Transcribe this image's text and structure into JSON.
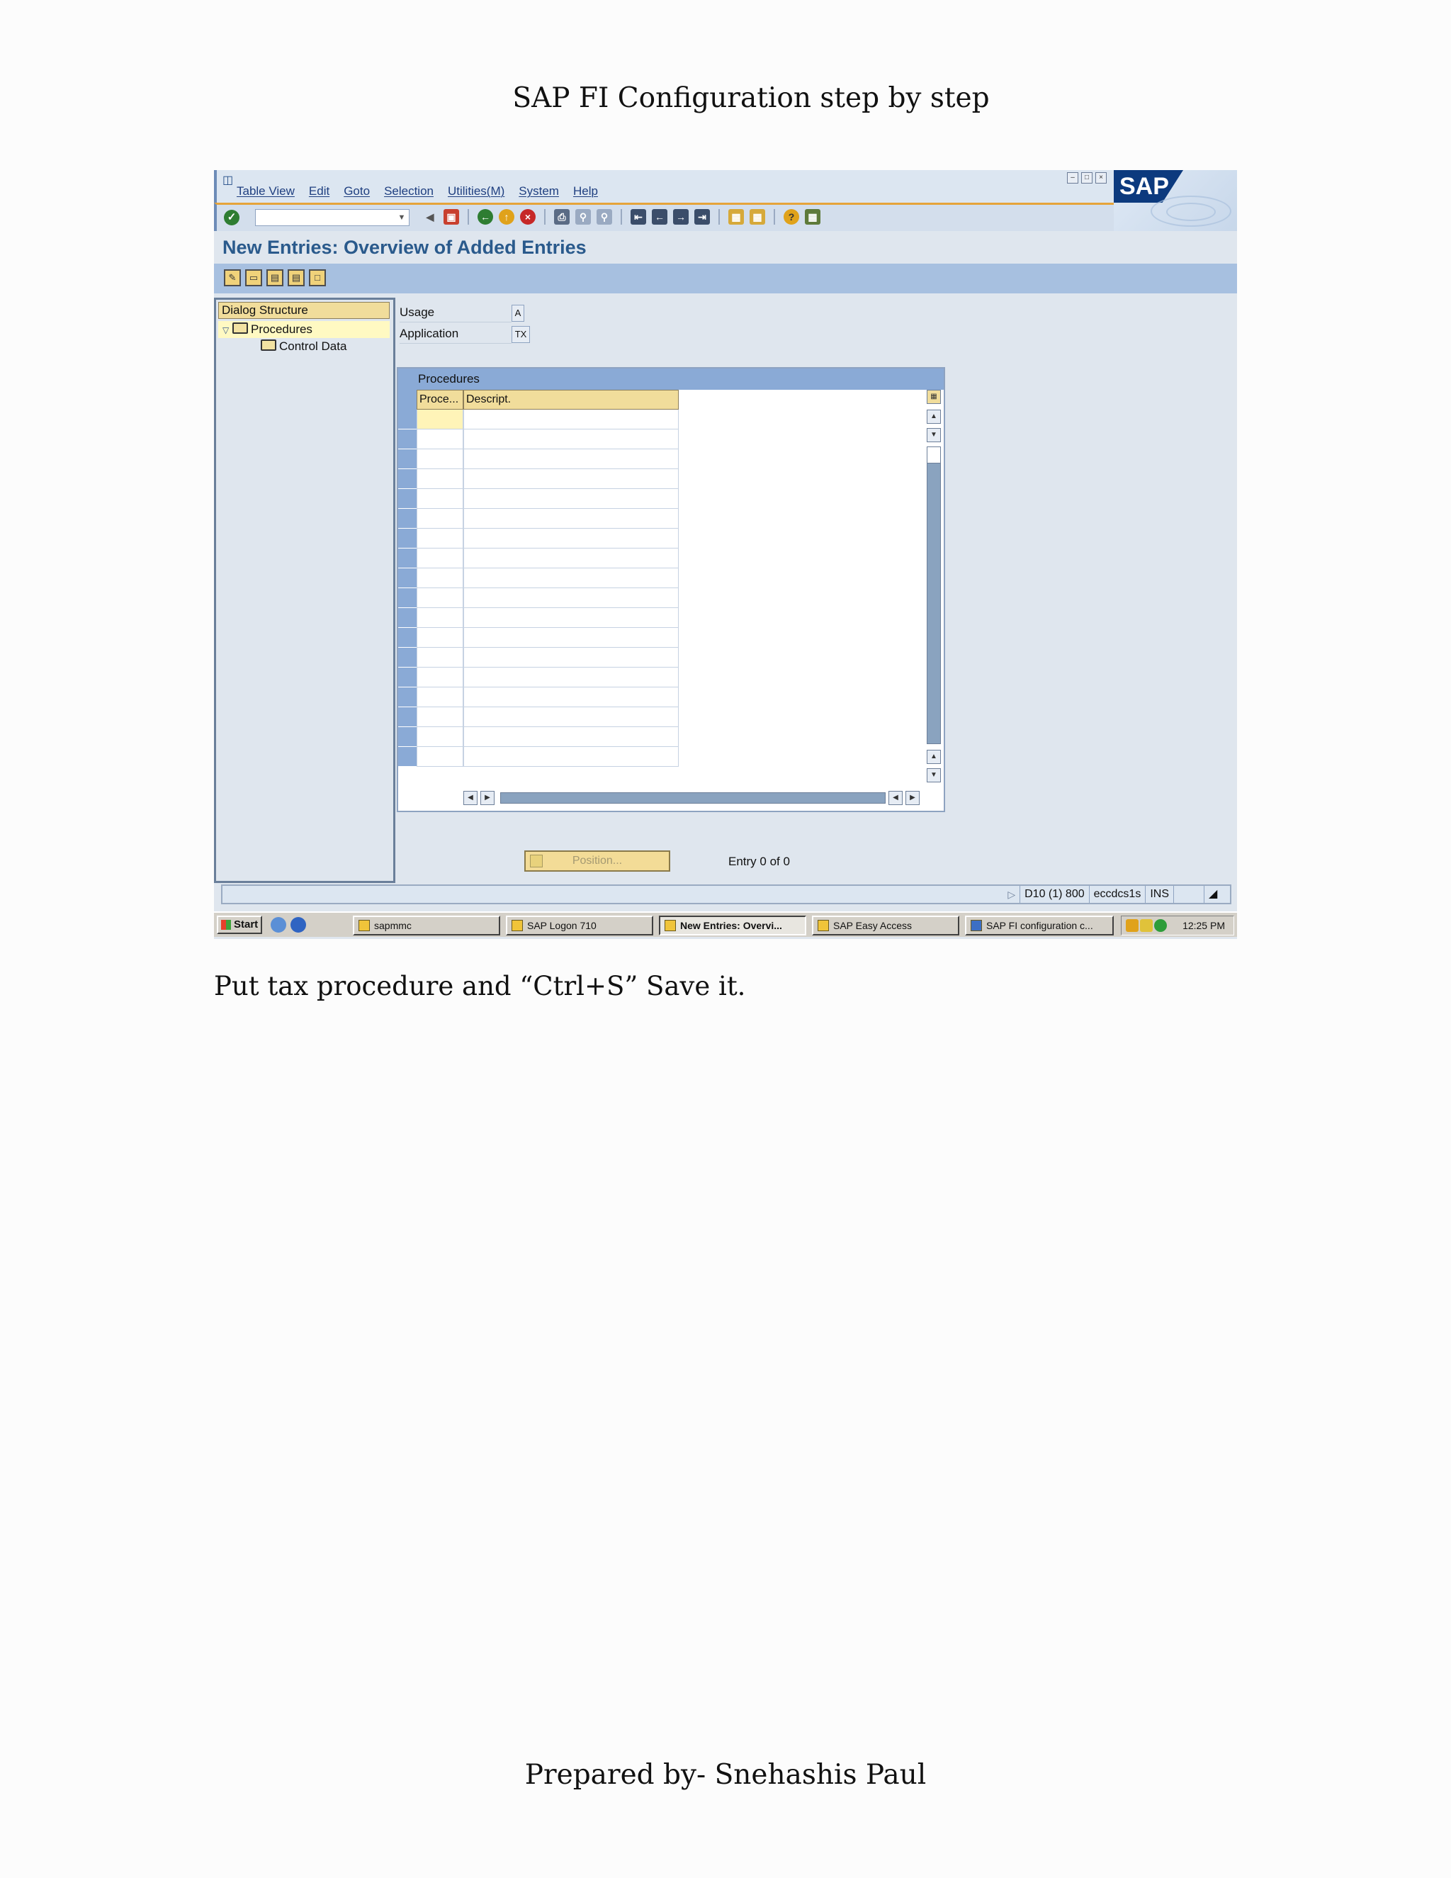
{
  "document": {
    "title": "SAP FI Configuration step by step",
    "caption": "Put tax procedure and “Ctrl+S” Save it.",
    "footer": "Prepared by- Snehashis Paul"
  },
  "sap": {
    "menu": [
      "Table View",
      "Edit",
      "Goto",
      "Selection",
      "Utilities(M)",
      "System",
      "Help"
    ],
    "logo_text": "SAP",
    "screen_title": "New Entries: Overview of Added Entries",
    "dialog_structure": {
      "header": "Dialog Structure",
      "items": [
        {
          "label": "Procedures",
          "selected": true,
          "level": 1
        },
        {
          "label": "Control Data",
          "selected": false,
          "level": 2
        }
      ]
    },
    "fields": [
      {
        "label": "Usage",
        "value": "A"
      },
      {
        "label": "Application",
        "value": "TX"
      }
    ],
    "table": {
      "title": "Procedures",
      "columns": [
        "Proce...",
        "Descript."
      ],
      "visible_rows": 18
    },
    "position_button": "Position...",
    "entry_info": "Entry 0 of 0",
    "status": {
      "system": "D10 (1) 800",
      "server": "eccdcs1s",
      "mode": "INS"
    },
    "taskbar": {
      "start": "Start",
      "buttons": [
        {
          "label": "sapmmc",
          "active": false
        },
        {
          "label": "SAP Logon 710",
          "active": false
        },
        {
          "label": "New Entries: Overvi...",
          "active": true
        },
        {
          "label": "SAP Easy Access",
          "active": false
        },
        {
          "label": "SAP FI configuration c...",
          "active": false
        }
      ],
      "time": "12:25 PM"
    },
    "colors": {
      "title_blue": "#2a5a8c",
      "header_yellow": "#f1dd9b",
      "accent_orange": "#e6a43a"
    }
  }
}
